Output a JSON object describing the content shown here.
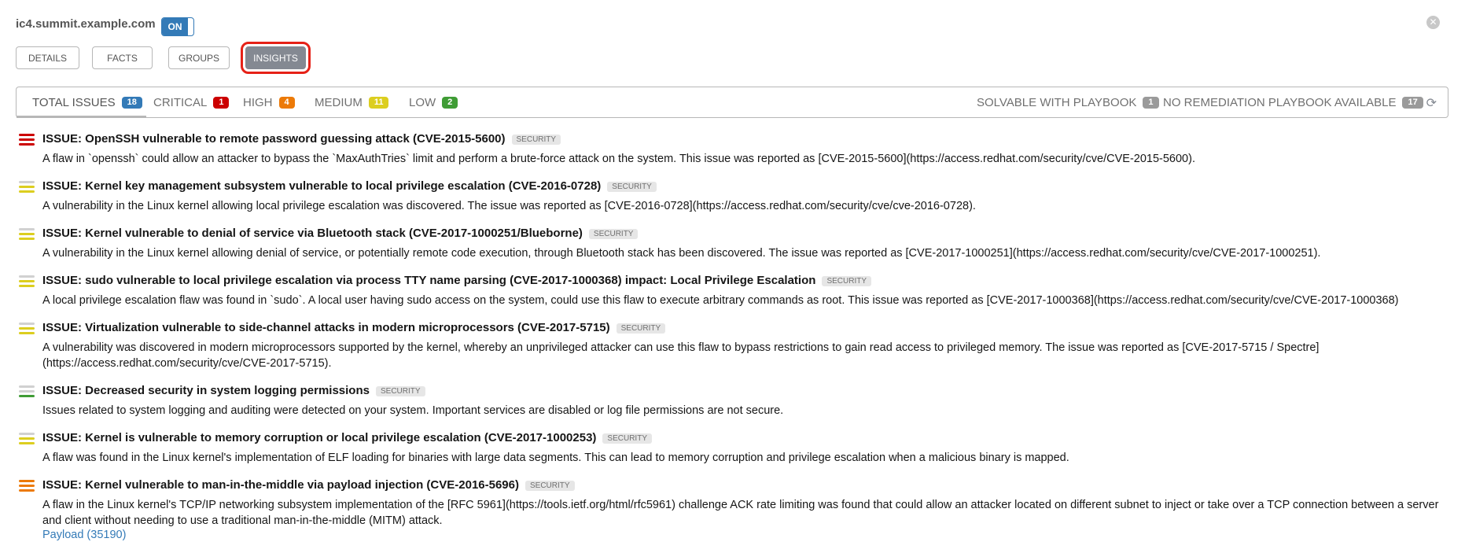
{
  "header": {
    "host_name": "ic4.summit.example.com",
    "toggle_label": "ON",
    "close_symbol": "✕"
  },
  "tabs": [
    {
      "label": "DETAILS"
    },
    {
      "label": "FACTS"
    },
    {
      "label": "GROUPS"
    },
    {
      "label": "INSIGHTS",
      "active": true
    }
  ],
  "filters": {
    "total": {
      "label": "TOTAL ISSUES",
      "count": "18"
    },
    "critical": {
      "label": "CRITICAL",
      "count": "1"
    },
    "high": {
      "label": "HIGH",
      "count": "4"
    },
    "medium": {
      "label": "MEDIUM",
      "count": "11"
    },
    "low": {
      "label": "LOW",
      "count": "2"
    },
    "solvable": {
      "label": "SOLVABLE WITH PLAYBOOK",
      "count": "1"
    },
    "no_playbook": {
      "label": "NO REMEDIATION PLAYBOOK AVAILABLE",
      "count": "17"
    },
    "refresh_symbol": "⟳"
  },
  "colors": {
    "accent": "#337ab7",
    "critical": "#cc0000",
    "high": "#ec7a08",
    "medium": "#dcce1f",
    "low": "#3f9c35",
    "neutral_badge": "#9a9a9a",
    "total_badge": "#337ab7"
  },
  "issues": [
    {
      "title": "ISSUE: OpenSSH vulnerable to remote password guessing attack (CVE-2015-5600)",
      "tag": "SECURITY",
      "severity": "critical",
      "description": "A flaw in `openssh` could allow an attacker to bypass the `MaxAuthTries` limit and perform a brute-force attack on the system. This issue was reported as [CVE-2015-5600](https://access.redhat.com/security/cve/CVE-2015-5600)."
    },
    {
      "title": "ISSUE: Kernel key management subsystem vulnerable to local privilege escalation (CVE-2016-0728)",
      "tag": "SECURITY",
      "severity": "medium",
      "description": "A vulnerability in the Linux kernel allowing local privilege escalation was discovered. The issue was reported as [CVE-2016-0728](https://access.redhat.com/security/cve/cve-2016-0728)."
    },
    {
      "title": "ISSUE: Kernel vulnerable to denial of service via Bluetooth stack (CVE-2017-1000251/Blueborne)",
      "tag": "SECURITY",
      "severity": "medium",
      "description": "A vulnerability in the Linux kernel allowing denial of service, or potentially remote code execution, through Bluetooth stack has been discovered. The issue was reported as [CVE-2017-1000251](https://access.redhat.com/security/cve/CVE-2017-1000251)."
    },
    {
      "title": "ISSUE: sudo vulnerable to local privilege escalation via process TTY name parsing (CVE-2017-1000368) impact: Local Privilege Escalation",
      "tag": "SECURITY",
      "severity": "medium",
      "description": "A local privilege escalation flaw was found in `sudo`. A local user having sudo access on the system, could use this flaw to execute arbitrary commands as root. This issue was reported as [CVE-2017-1000368](https://access.redhat.com/security/cve/CVE-2017-1000368)"
    },
    {
      "title": "ISSUE: Virtualization vulnerable to side-channel attacks in modern microprocessors (CVE-2017-5715)",
      "tag": "SECURITY",
      "severity": "medium",
      "description": "A vulnerability was discovered in modern microprocessors supported by the kernel, whereby an unprivileged attacker can use this flaw to bypass restrictions to gain read access to privileged memory. The issue was reported as [CVE-2017-5715 / Spectre](https://access.redhat.com/security/cve/CVE-2017-5715)."
    },
    {
      "title": "ISSUE: Decreased security in system logging permissions",
      "tag": "SECURITY",
      "severity": "low",
      "description": "Issues related to system logging and auditing were detected on your system. Important services are disabled or log file permissions are not secure."
    },
    {
      "title": "ISSUE: Kernel is vulnerable to memory corruption or local privilege escalation (CVE-2017-1000253)",
      "tag": "SECURITY",
      "severity": "medium",
      "description": "A flaw was found in the Linux kernel's implementation of ELF loading for binaries with large data segments. This can lead to memory corruption and privilege escalation when a malicious binary is mapped."
    },
    {
      "title": "ISSUE: Kernel vulnerable to man-in-the-middle via payload injection (CVE-2016-5696)",
      "tag": "SECURITY",
      "severity": "high",
      "description": "A flaw in the Linux kernel's TCP/IP networking subsystem implementation of the [RFC 5961](https://tools.ietf.org/html/rfc5961) challenge ACK rate limiting was found that could allow an attacker located on different subnet to inject or take over a TCP connection between a server and client without needing to use a traditional man-in-the-middle (MITM) attack.",
      "link": "Payload (35190)"
    }
  ]
}
